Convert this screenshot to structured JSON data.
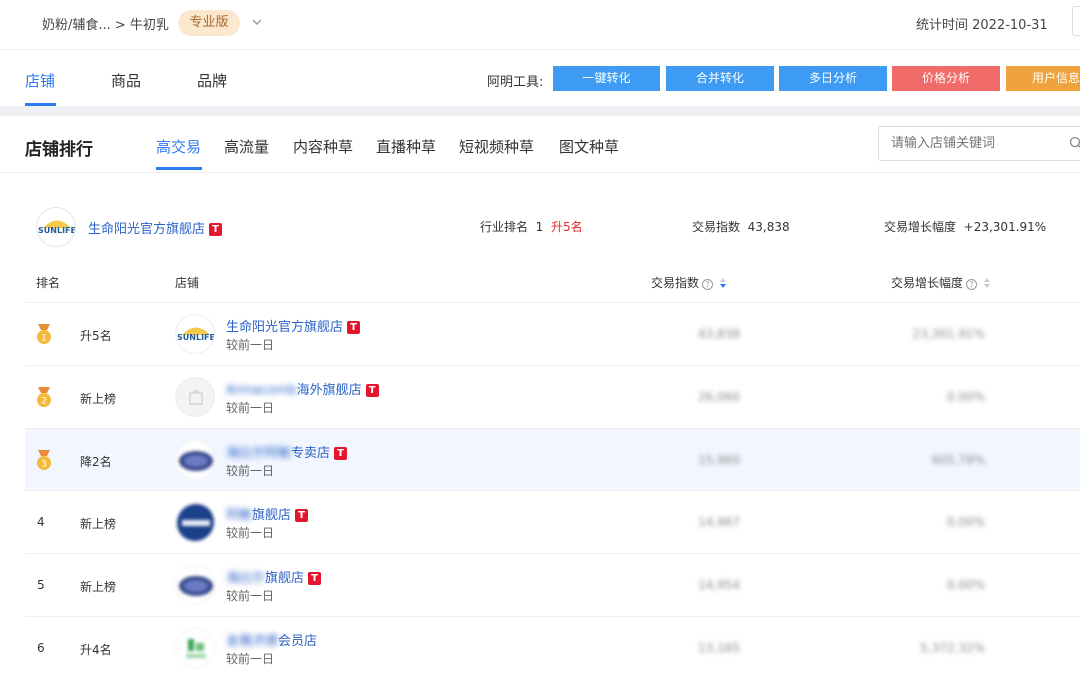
{
  "topbar": {
    "breadcrumb": "奶粉/辅食... > 牛初乳",
    "edition_badge": "专业版",
    "stat_time": "统计时间 2022-10-31"
  },
  "nav": {
    "tabs": [
      {
        "label": "店铺"
      },
      {
        "label": "商品"
      },
      {
        "label": "品牌"
      }
    ],
    "tools_label": "阿明工具:",
    "tool_buttons": [
      {
        "label": "一键转化",
        "color": "#3d9bf4"
      },
      {
        "label": "合并转化",
        "color": "#3d9bf4"
      },
      {
        "label": "多日分析",
        "color": "#3d9bf4"
      },
      {
        "label": "价格分析",
        "color": "#f26b6b"
      },
      {
        "label": "用户信息",
        "color": "#f0a23c"
      }
    ]
  },
  "ranking": {
    "title": "店铺排行",
    "subtabs": [
      {
        "label": "高交易"
      },
      {
        "label": "高流量"
      },
      {
        "label": "内容种草"
      },
      {
        "label": "直播种草"
      },
      {
        "label": "短视频种草"
      },
      {
        "label": "图文种草"
      }
    ],
    "search_placeholder": "请输入店铺关键词"
  },
  "summary": {
    "shop_name": "生命阳光官方旗舰店",
    "tmall_mark": "T",
    "industry_rank_label": "行业排名",
    "industry_rank": "1",
    "rank_change": "升5名",
    "index_label": "交易指数",
    "index_value": "43,838",
    "growth_label": "交易增长幅度",
    "growth_value": "+23,301.91%"
  },
  "table": {
    "headers": {
      "rank": "排名",
      "shop": "店铺",
      "index": "交易指数",
      "growth": "交易增长幅度"
    },
    "rows": [
      {
        "rank": "1",
        "change": "升5名",
        "change_type": "up",
        "name_blur": "",
        "name_clear": "生命阳光官方旗舰店",
        "compare": "较前一日",
        "index": "43,838",
        "growth": "23,301.91%"
      },
      {
        "rank": "2",
        "change": "新上榜",
        "change_type": "new",
        "name_blur": "Armacomb",
        "name_clear": "海外旗舰店",
        "compare": "较前一日",
        "index": "26,060",
        "growth": "0.00%"
      },
      {
        "rank": "3",
        "change": "降2名",
        "change_type": "down",
        "name_blur": "海比尔阿敏",
        "name_clear": "专卖店",
        "compare": "较前一日",
        "index": "15,960",
        "growth": "605.78%"
      },
      {
        "rank": "4",
        "change": "新上榜",
        "change_type": "new",
        "name_blur": "阿敏",
        "name_clear": "旗舰店",
        "compare": "较前一日",
        "index": "14,967",
        "growth": "0.00%"
      },
      {
        "rank": "5",
        "change": "新上榜",
        "change_type": "new",
        "name_blur": "海比尔",
        "name_clear": "旗舰店",
        "compare": "较前一日",
        "index": "14,954",
        "growth": "0.00%"
      },
      {
        "rank": "6",
        "change": "升4名",
        "change_type": "up",
        "name_blur": "金雅济德",
        "name_clear": "会员店",
        "compare": "较前一日",
        "index": "13,165",
        "growth": "5,372.32%"
      }
    ]
  }
}
